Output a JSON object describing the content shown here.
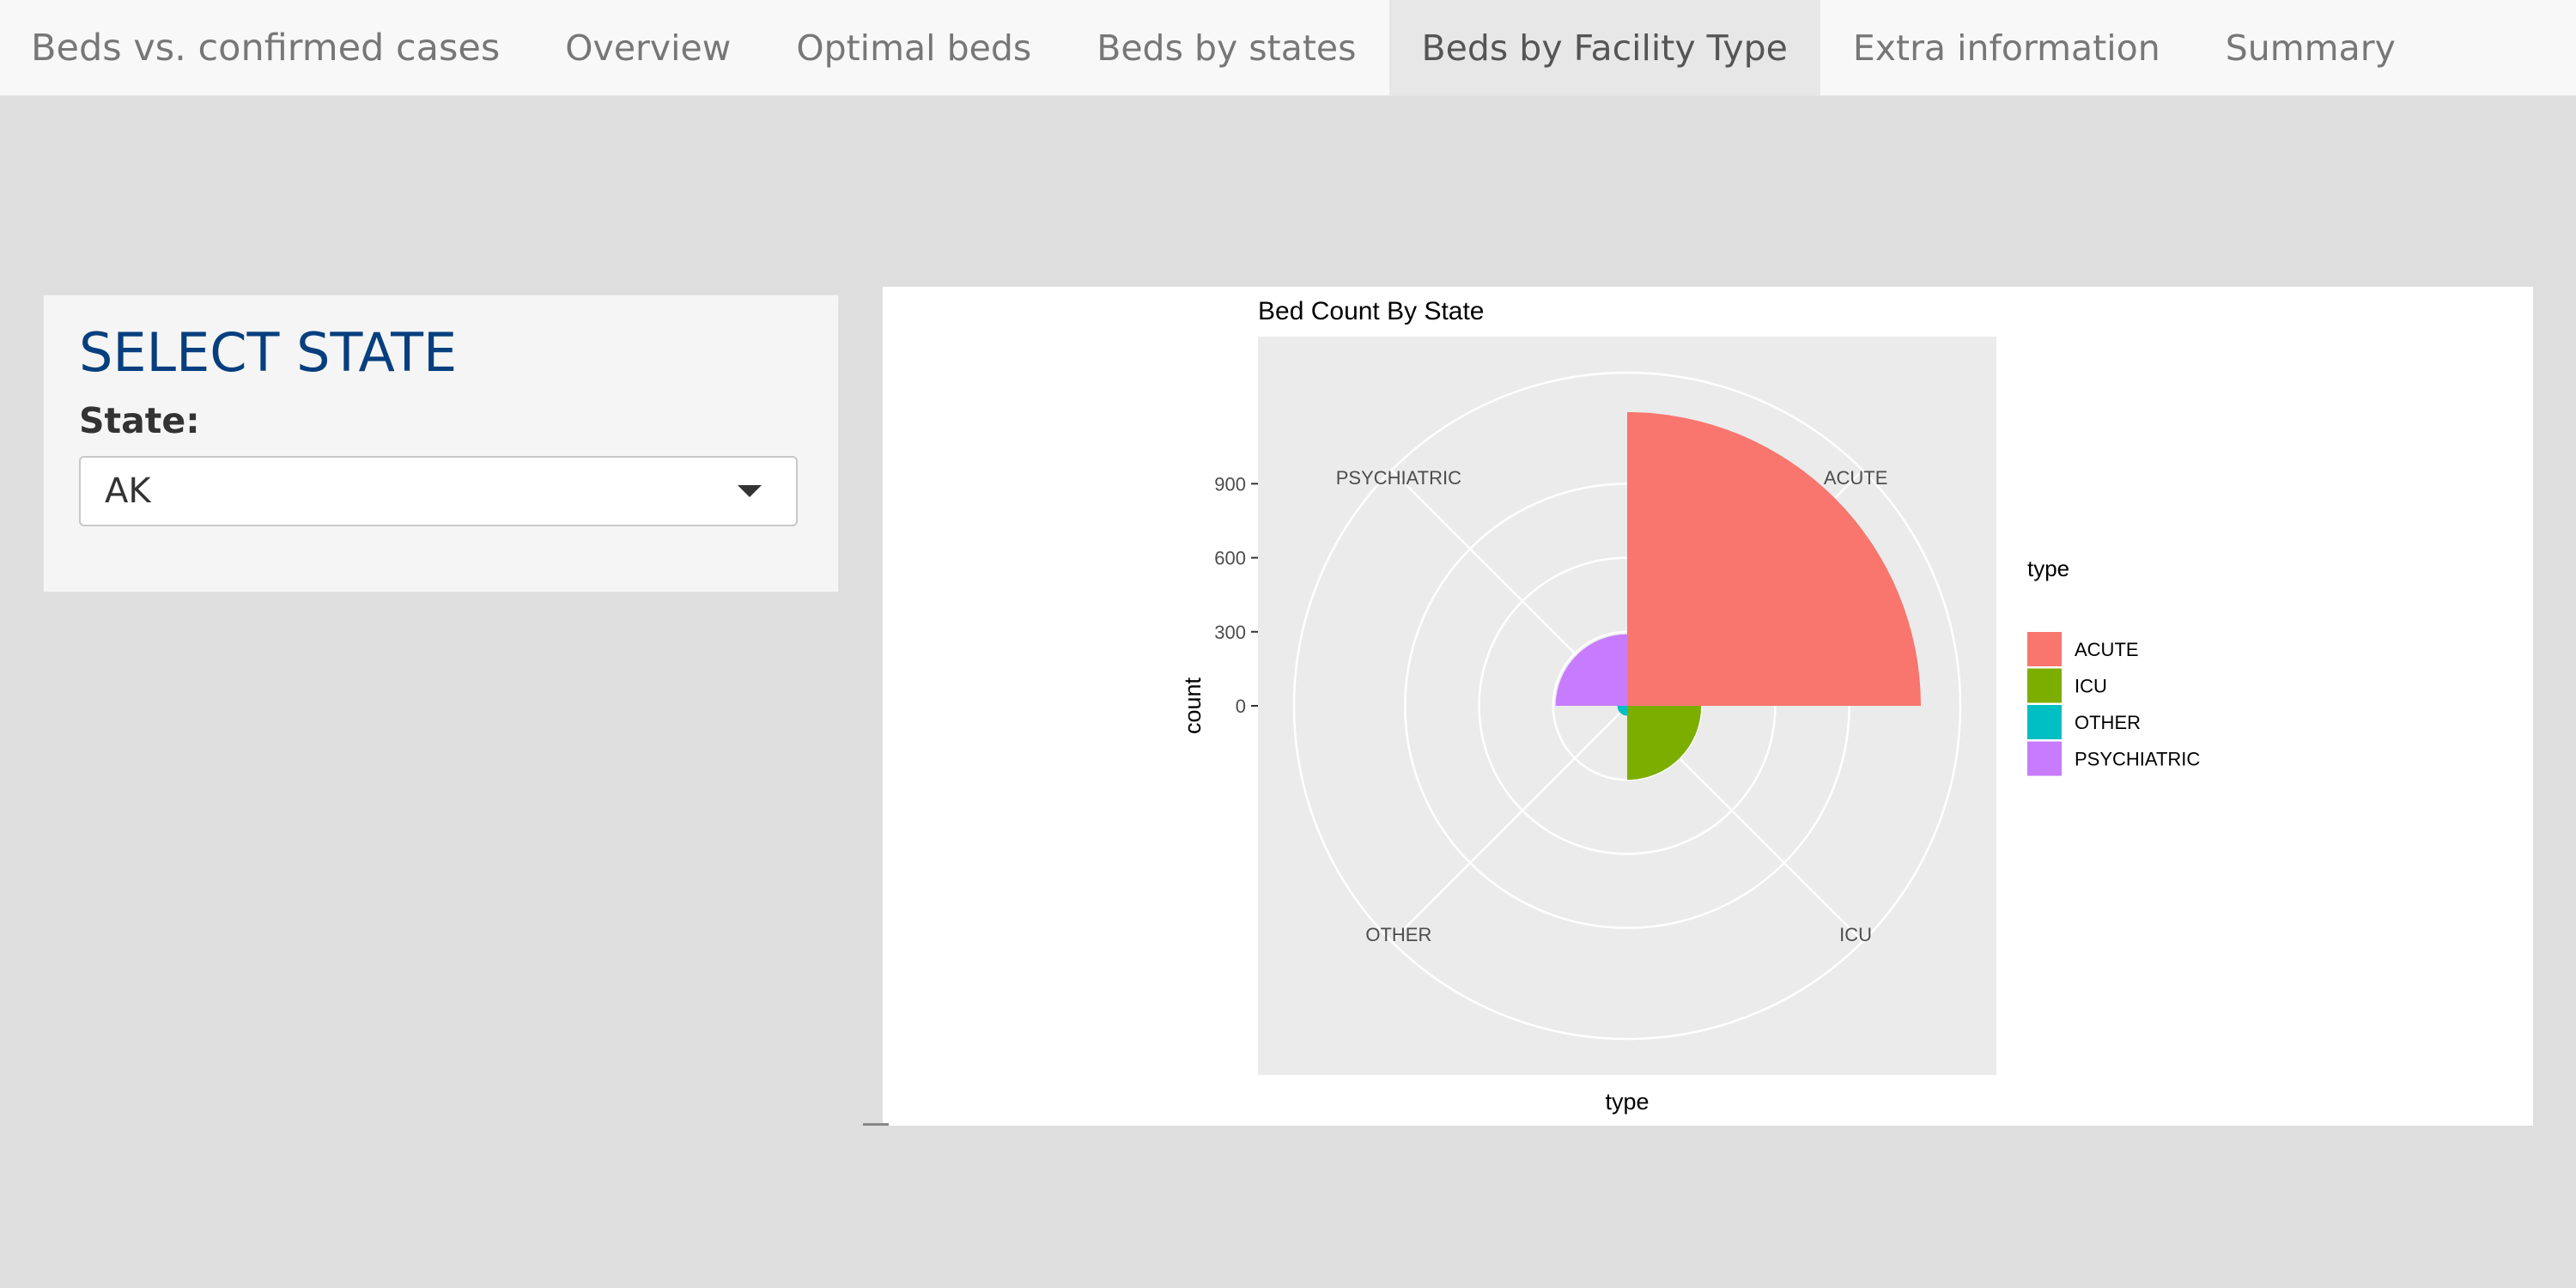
{
  "navbar": {
    "brand": "Beds vs. confirmed cases",
    "tabs": [
      {
        "label": "Overview",
        "active": false
      },
      {
        "label": "Optimal beds",
        "active": false
      },
      {
        "label": "Beds by states",
        "active": false
      },
      {
        "label": "Beds by Facility Type",
        "active": true
      },
      {
        "label": "Extra information",
        "active": false
      },
      {
        "label": "Summary",
        "active": false
      }
    ]
  },
  "sidebar": {
    "title": "SELECT STATE",
    "state_label": "State:",
    "state_value": "AK"
  },
  "colors": {
    "ACUTE": "#f8766d",
    "ICU": "#7cae00",
    "OTHER": "#00bfc4",
    "PSYCHIATRIC": "#c77cff",
    "panel_bg": "#ebebeb",
    "grid": "#ffffff"
  },
  "chart_data": {
    "type": "polar-bar",
    "title": "Bed Count By State",
    "xlabel": "type",
    "ylabel": "count",
    "categories": [
      "ACUTE",
      "ICU",
      "OTHER",
      "PSYCHIATRIC"
    ],
    "values": [
      1190,
      300,
      40,
      290
    ],
    "y_ticks": [
      0,
      300,
      600,
      900
    ],
    "legend_title": "type",
    "legend_placement": "right"
  }
}
